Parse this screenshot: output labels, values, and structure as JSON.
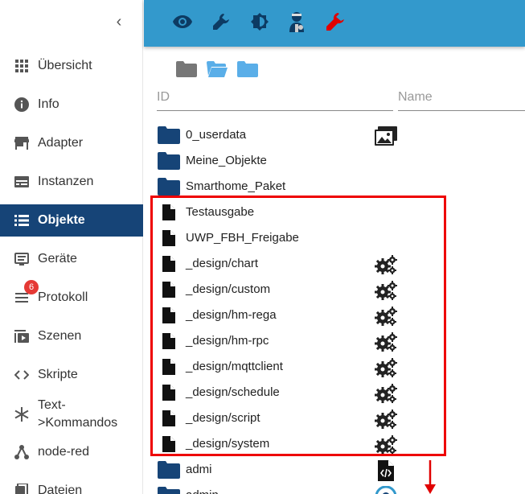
{
  "sidebar": {
    "collapse_icon": "chevron-left-icon",
    "items": [
      {
        "label": "Übersicht",
        "icon": "apps-grid-icon"
      },
      {
        "label": "Info",
        "icon": "info-icon"
      },
      {
        "label": "Adapter",
        "icon": "store-icon"
      },
      {
        "label": "Instanzen",
        "icon": "instances-icon"
      },
      {
        "label": "Objekte",
        "icon": "list-icon",
        "active": true
      },
      {
        "label": "Geräte",
        "icon": "devices-icon"
      },
      {
        "label": "Protokoll",
        "icon": "log-icon",
        "badge": "6"
      },
      {
        "label": "Szenen",
        "icon": "scenes-icon"
      },
      {
        "label": "Skripte",
        "icon": "code-icon"
      },
      {
        "label_line1": "Text-",
        "label_line2": ">Kommandos",
        "icon": "asterisk-icon"
      },
      {
        "label": "node-red",
        "icon": "node-icon"
      },
      {
        "label": "Dateien",
        "icon": "files-icon"
      }
    ]
  },
  "toolbar": {
    "buttons": [
      "eye-icon",
      "wrench-icon",
      "brightness-icon",
      "expert-user-icon",
      "red-wrench-icon"
    ],
    "accent": "#3399cc",
    "alert_color": "#e00000"
  },
  "folder_bar": [
    "folder-grey-icon",
    "folder-open-icon",
    "folder-blue-icon"
  ],
  "columns": {
    "id_placeholder": "ID",
    "name_placeholder": "Name"
  },
  "rows": [
    {
      "type": "folder",
      "label": "0_userdata",
      "right_icon": "image-gallery-icon"
    },
    {
      "type": "folder",
      "label": "Meine_Objekte"
    },
    {
      "type": "folder",
      "label": "Smarthome_Paket"
    },
    {
      "type": "file",
      "label": "Testausgabe"
    },
    {
      "type": "file",
      "label": "UWP_FBH_Freigabe"
    },
    {
      "type": "file",
      "label": "_design/chart",
      "right_icon": "gears-icon"
    },
    {
      "type": "file",
      "label": "_design/custom",
      "right_icon": "gears-icon"
    },
    {
      "type": "file",
      "label": "_design/hm-rega",
      "right_icon": "gears-icon"
    },
    {
      "type": "file",
      "label": "_design/hm-rpc",
      "right_icon": "gears-icon"
    },
    {
      "type": "file",
      "label": "_design/mqttclient",
      "right_icon": "gears-icon"
    },
    {
      "type": "file",
      "label": "_design/schedule",
      "right_icon": "gears-icon"
    },
    {
      "type": "file",
      "label": "_design/script",
      "right_icon": "gears-icon"
    },
    {
      "type": "file",
      "label": "_design/system",
      "right_icon": "gears-icon"
    },
    {
      "type": "folder",
      "label": "admi",
      "right_icon": "code-file-icon"
    },
    {
      "type": "folder",
      "label": "admin",
      "right_icon": "admin-logo-icon"
    }
  ]
}
